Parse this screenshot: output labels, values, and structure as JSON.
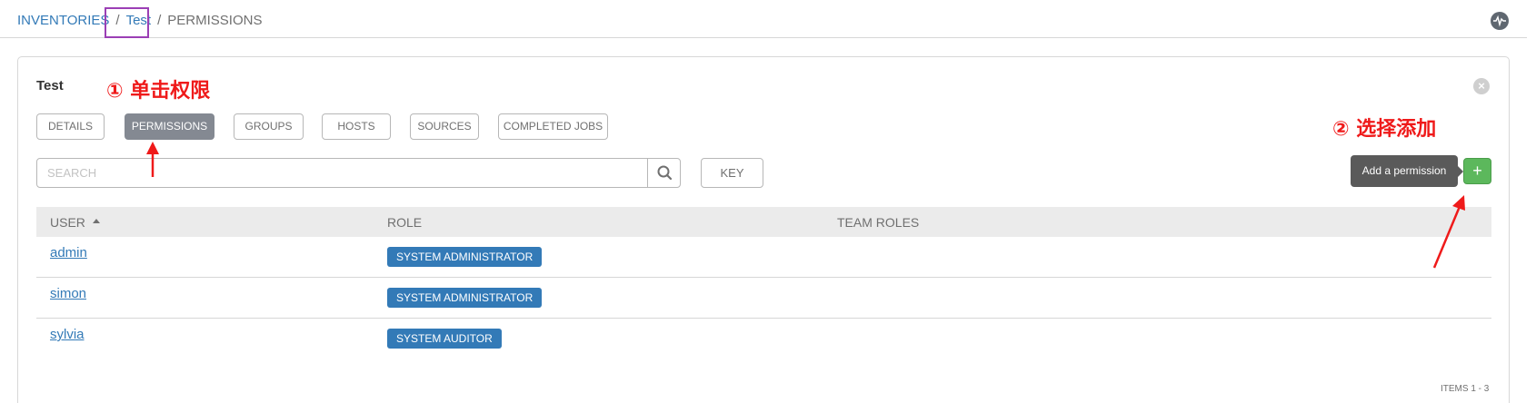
{
  "breadcrumb": {
    "items": [
      "INVENTORIES",
      "Test",
      "PERMISSIONS"
    ],
    "separator": "/"
  },
  "header": {
    "activity_icon": "pulse-icon"
  },
  "panel": {
    "title": "Test",
    "close_icon": "close-icon",
    "tabs": [
      {
        "label": "DETAILS",
        "active": false
      },
      {
        "label": "PERMISSIONS",
        "active": true
      },
      {
        "label": "GROUPS",
        "active": false
      },
      {
        "label": "HOSTS",
        "active": false
      },
      {
        "label": "SOURCES",
        "active": false
      },
      {
        "label": "COMPLETED JOBS",
        "active": false
      }
    ],
    "search": {
      "placeholder": "SEARCH",
      "value": "",
      "icon": "search-icon"
    },
    "key_button": "KEY",
    "add_button": {
      "label": "+",
      "tooltip": "Add a permission"
    }
  },
  "table": {
    "columns": [
      "USER",
      "ROLE",
      "TEAM ROLES"
    ],
    "sort_column": "USER",
    "rows": [
      {
        "user": "admin",
        "role": "SYSTEM ADMINISTRATOR",
        "team_roles": ""
      },
      {
        "user": "simon",
        "role": "SYSTEM ADMINISTRATOR",
        "team_roles": ""
      },
      {
        "user": "sylvia",
        "role": "SYSTEM AUDITOR",
        "team_roles": ""
      }
    ]
  },
  "footer": {
    "items": "ITEMS  1 - 3"
  },
  "annotations": {
    "step1": "① 单击权限",
    "step2": "② 选择添加"
  },
  "colors": {
    "link": "#337ab7",
    "active_tab": "#848992",
    "add_button": "#5cb85c",
    "annotation": "#ef1a1a",
    "highlight_box": "#9b3fb5"
  }
}
